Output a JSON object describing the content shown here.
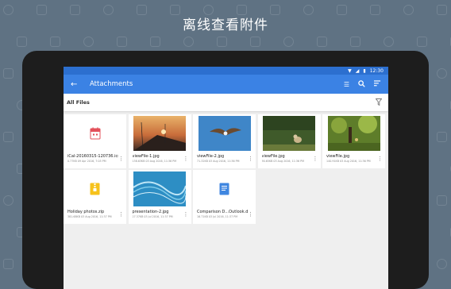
{
  "headline": "离线查看附件",
  "status": {
    "time": "12:30"
  },
  "toolbar": {
    "title": "Attachments"
  },
  "filter": {
    "label": "All Files"
  },
  "files": [
    {
      "name": "iCal-20160315-120736.ics",
      "meta": "0.77KB 09 Apr 2016, 7:05 PM",
      "kind": "calendar"
    },
    {
      "name": "viewFile-1.jpg",
      "meta": "158.63KB 03 Aug 2016, 11:36 PM",
      "kind": "photo-sunset"
    },
    {
      "name": "viewFile-2.jpg",
      "meta": "71.32KB 03 Aug 2016, 11:36 PM",
      "kind": "photo-bird"
    },
    {
      "name": "viewFile.jpg",
      "meta": "90.65KB 03 Aug 2016, 11:36 PM",
      "kind": "photo-dog"
    },
    {
      "name": "viewFile.jpg",
      "meta": "140.91KB 03 Aug 2016, 11:36 PM",
      "kind": "photo-garden"
    },
    {
      "name": "Holiday photos.zip",
      "meta": "381.68KB 03 Aug 2016, 11:37 PM",
      "kind": "zip"
    },
    {
      "name": "presentation-2.jpg",
      "meta": "27.37KB 03 Jul 2016, 11:37 PM",
      "kind": "photo-wave"
    },
    {
      "name": "Comparison D...Outlook.docx",
      "meta": "16.71KB 03 Jul 2016, 11:37 PM",
      "kind": "docx"
    }
  ],
  "colors": {
    "appbar": "#3b82e4",
    "statusbar": "#2c6fcf",
    "background": "#5f7283"
  }
}
